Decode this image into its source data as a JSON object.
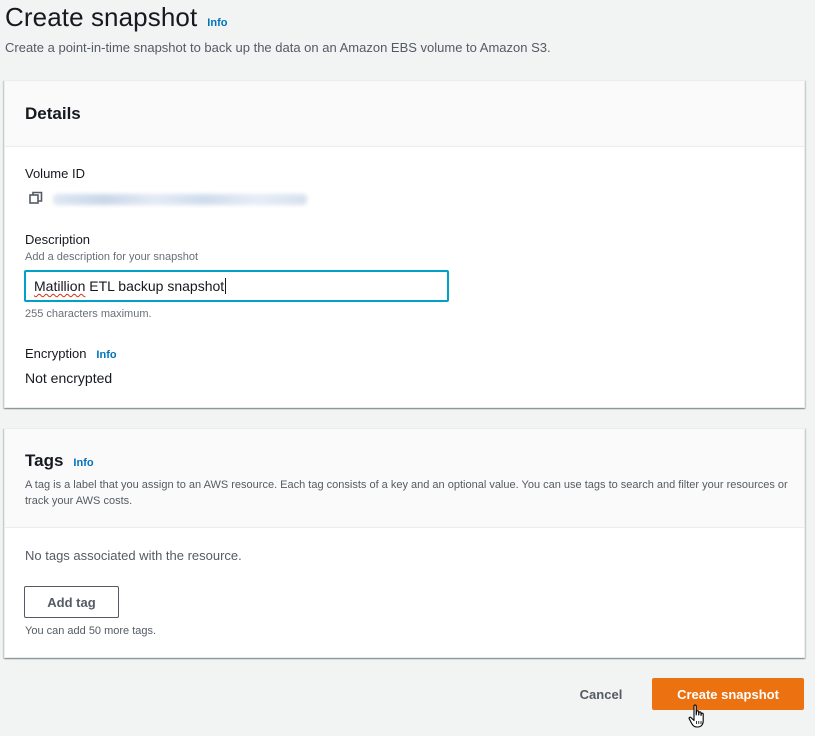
{
  "header": {
    "title": "Create snapshot",
    "info": "Info",
    "description": "Create a point-in-time snapshot to back up the data on an Amazon EBS volume to Amazon S3."
  },
  "details": {
    "title": "Details",
    "volume_id_label": "Volume ID",
    "description_label": "Description",
    "description_hint": "Add a description for your snapshot",
    "description_value_misspelled": "Matillion",
    "description_value_rest": " ETL backup snapshot",
    "description_constraint": "255 characters maximum.",
    "encryption_label": "Encryption",
    "encryption_info": "Info",
    "encryption_value": "Not encrypted"
  },
  "tags": {
    "title": "Tags",
    "info": "Info",
    "description": "A tag is a label that you assign to an AWS resource. Each tag consists of a key and an optional value. You can use tags to search and filter your resources or track your AWS costs.",
    "empty_text": "No tags associated with the resource.",
    "add_button": "Add tag",
    "remaining_text": "You can add 50 more tags."
  },
  "footer": {
    "cancel_label": "Cancel",
    "submit_label": "Create snapshot"
  },
  "colors": {
    "primary": "#ec7211",
    "link": "#0073bb",
    "focus": "#00a1c9"
  }
}
